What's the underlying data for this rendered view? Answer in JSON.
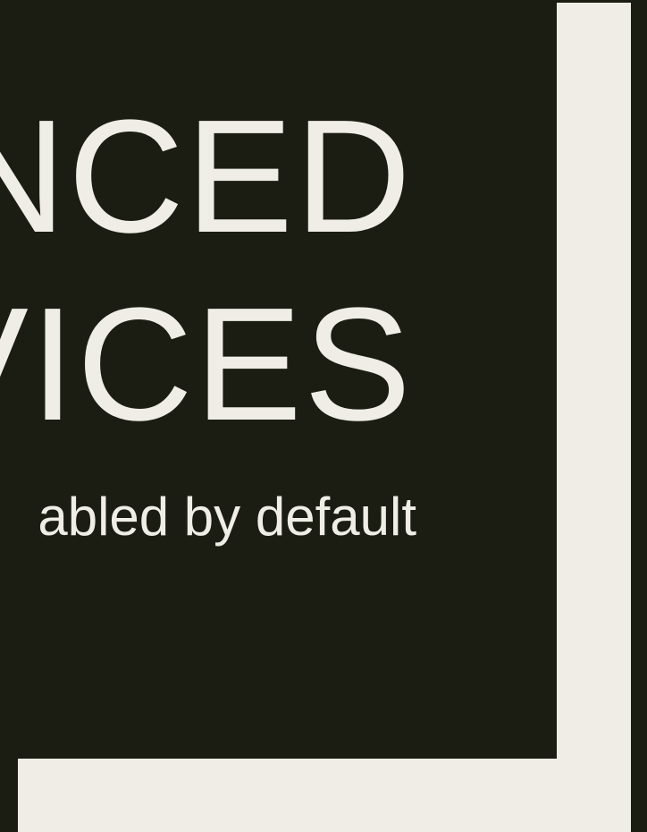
{
  "slide": {
    "title_line_1": "NCED",
    "title_line_2": "VICES",
    "subtitle": "abled by default"
  },
  "colors": {
    "background": "#1b1d12",
    "accent_frame": "#efede5",
    "text": "#efede5"
  }
}
